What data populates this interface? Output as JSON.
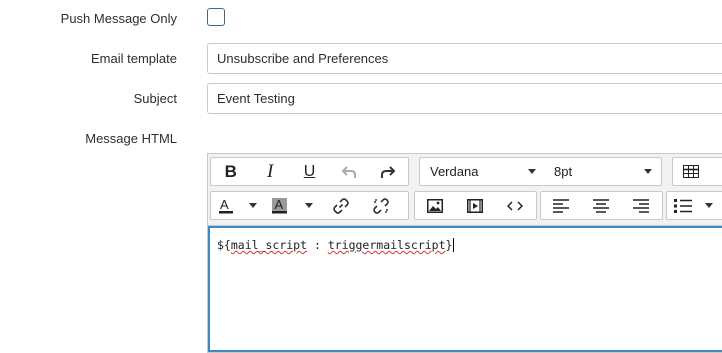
{
  "form": {
    "push_only_label": "Push Message Only",
    "push_only_checked": false,
    "email_template_label": "Email template",
    "email_template_value": "Unsubscribe and Preferences",
    "subject_label": "Subject",
    "subject_value": "Event Testing",
    "message_html_label": "Message HTML"
  },
  "editor": {
    "font_family": "Verdana",
    "font_size": "8pt",
    "content_prefix": "${",
    "content_token_1": "mail_script",
    "content_sep": " : ",
    "content_token_2": "triggermailscript",
    "content_suffix": "}"
  },
  "icons": {
    "bold": "bold-icon",
    "italic": "italic-icon",
    "underline": "underline-icon",
    "undo": "undo-icon",
    "redo": "redo-icon",
    "table": "table-icon",
    "text_color": "text-color-icon",
    "background_color": "background-color-icon",
    "link": "link-icon",
    "unlink": "unlink-icon",
    "image": "image-icon",
    "video": "video-icon",
    "code": "code-icon",
    "align_left": "align-left-icon",
    "align_center": "align-center-icon",
    "align_right": "align-right-icon",
    "bullet_list": "bullet-list-icon"
  },
  "colors": {
    "accent": "#3e89c4",
    "checkbox_border": "#3c6b80",
    "text": "#2e2e2e"
  }
}
